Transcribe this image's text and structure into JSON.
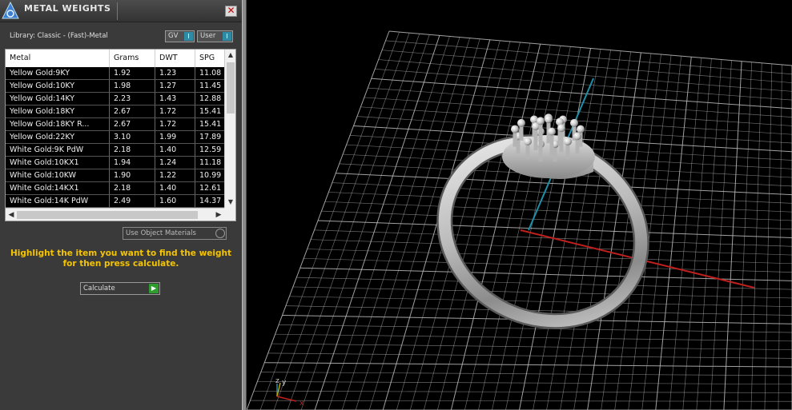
{
  "panel": {
    "title": "METAL WEIGHTS",
    "close_icon": "close-icon",
    "library_label": "Library: Classic - (Fast)-Metal",
    "gv_toggle": "GV",
    "user_toggle": "User",
    "toggle_indicator": "I",
    "columns": [
      "Metal",
      "Grams",
      "DWT",
      "SPG"
    ],
    "rows": [
      [
        "Yellow Gold:9KY",
        "1.92",
        "1.23",
        "11.08"
      ],
      [
        "Yellow Gold:10KY",
        "1.98",
        "1.27",
        "11.45"
      ],
      [
        "Yellow Gold:14KY",
        "2.23",
        "1.43",
        "12.88"
      ],
      [
        "Yellow Gold:18KY",
        "2.67",
        "1.72",
        "15.41"
      ],
      [
        "Yellow Gold:18KY R...",
        "2.67",
        "1.72",
        "15.41"
      ],
      [
        "Yellow Gold:22KY",
        "3.10",
        "1.99",
        "17.89"
      ],
      [
        "White Gold:9K PdW",
        "2.18",
        "1.40",
        "12.59"
      ],
      [
        "White Gold:10KX1",
        "1.94",
        "1.24",
        "11.18"
      ],
      [
        "White Gold:10KW",
        "1.90",
        "1.22",
        "10.99"
      ],
      [
        "White Gold:14KX1",
        "2.18",
        "1.40",
        "12.61"
      ],
      [
        "White Gold:14K PdW",
        "2.49",
        "1.60",
        "14.37"
      ]
    ],
    "use_object_materials": "Use Object Materials",
    "hint_line1": "Highlight the item you want to find the weight",
    "hint_line2": "for then press calculate.",
    "calculate_label": "Calculate"
  },
  "viewport": {
    "axis_labels": {
      "x": "x",
      "y": "y",
      "z": "z"
    },
    "colors": {
      "grid": "#bdbdbd",
      "x_axis": "#c0201d",
      "y_axis": "#1f8fa8",
      "ring": "#d8d8d8"
    }
  }
}
